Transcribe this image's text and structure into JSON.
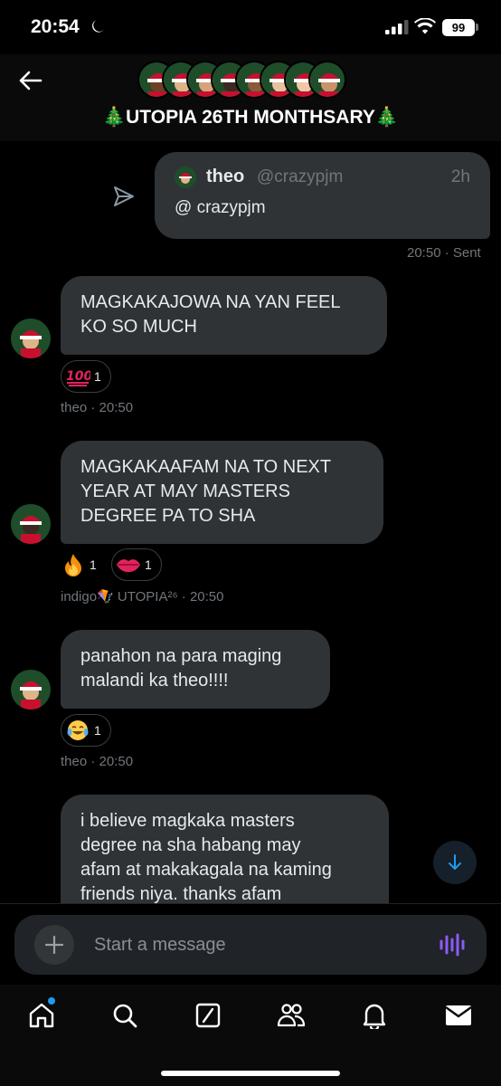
{
  "status_bar": {
    "time": "20:54",
    "battery": "99"
  },
  "header": {
    "title": "🎄UTOPIA 26TH MONTHSARY🎄",
    "icons": {
      "back": "arrow-left-icon"
    }
  },
  "messages": {
    "quote": {
      "name": "theo",
      "handle": "@crazypjm",
      "time": "2h",
      "text": "@ crazypjm",
      "meta": "20:50 · Sent"
    },
    "items": [
      {
        "text_lines": [
          "MAGKAKAJOWA NA YAN FEEL",
          "KO SO MUCH"
        ],
        "reaction_emoji": "💯",
        "reaction_count": "1",
        "meta": "theo · 20:50"
      },
      {
        "text_lines": [
          "MAGKAKAAFAM NA TO NEXT",
          "YEAR AT MAY MASTERS",
          "DEGREE PA TO SHA"
        ],
        "reaction_emoji_1": "🔥",
        "reaction_count_1": "1",
        "reaction_emoji_2": "👄",
        "reaction_count_2": "1",
        "meta": "indigo🪁 UTOPIA²⁶ · 20:50"
      },
      {
        "text_lines": [
          "panahon na para maging",
          "malandi ka theo!!!!"
        ],
        "reaction_emoji": "😂",
        "reaction_count": "1",
        "meta": "theo · 20:50"
      },
      {
        "text_lines": [
          "i believe magkaka masters",
          "degree na sha habang may",
          "afam at makakagala na kaming",
          "friends niya. thanks afam"
        ]
      }
    ]
  },
  "composer": {
    "placeholder": "Start a message"
  },
  "nav": {
    "items": [
      "home",
      "search",
      "grok",
      "communities",
      "notifications",
      "messages"
    ]
  },
  "colors": {
    "background": "#000000",
    "bubble": "#2f3336",
    "muted": "#71767b",
    "accent": "#1d9bf0",
    "voice": "#8b5cf6"
  }
}
